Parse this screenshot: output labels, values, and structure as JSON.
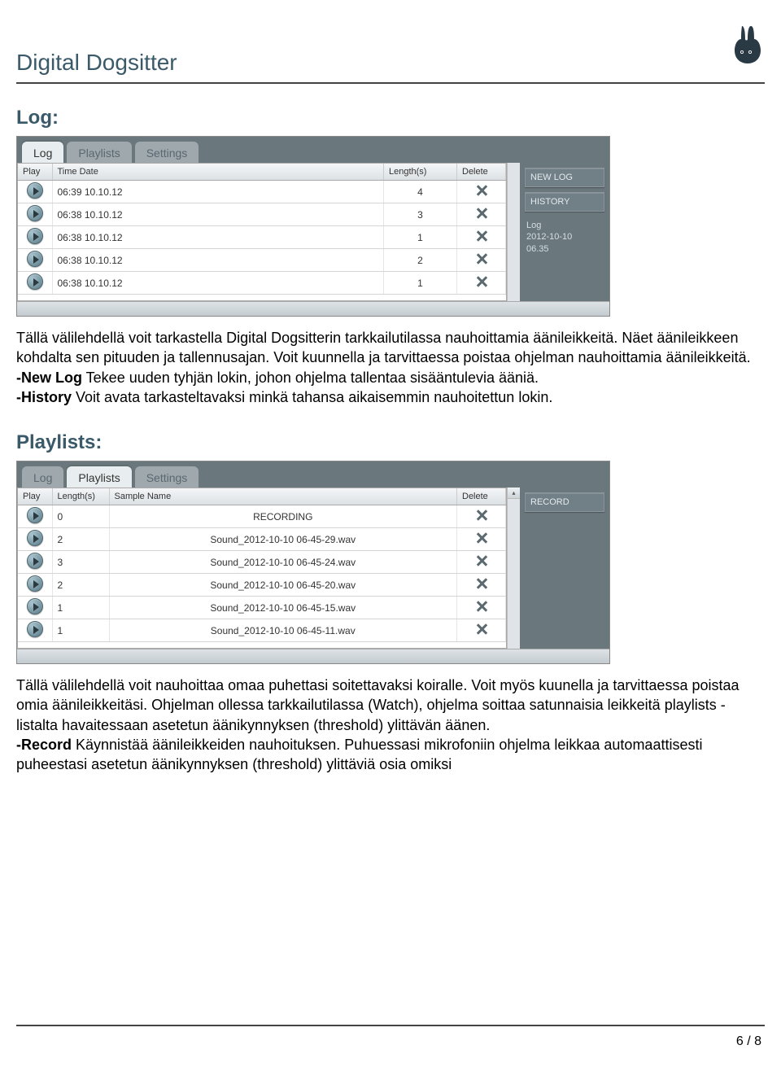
{
  "doc": {
    "title": "Digital Dogsitter",
    "page_num": "6 / 8"
  },
  "log_section": {
    "heading": "Log:",
    "tabs": [
      "Log",
      "Playlists",
      "Settings"
    ],
    "active_tab": 0,
    "columns": [
      "Play",
      "Time Date",
      "Length(s)",
      "Delete"
    ],
    "rows": [
      {
        "time": "06:39 10.10.12",
        "length": "4"
      },
      {
        "time": "06:38 10.10.12",
        "length": "3"
      },
      {
        "time": "06:38 10.10.12",
        "length": "1"
      },
      {
        "time": "06:38 10.10.12",
        "length": "2"
      },
      {
        "time": "06:38 10.10.12",
        "length": "1"
      }
    ],
    "side_buttons": [
      "NEW LOG",
      "HISTORY"
    ],
    "side_info_lines": [
      "Log",
      "2012-10-10",
      "06.35"
    ],
    "description": "Tällä välilehdellä voit tarkastella Digital Dogsitterin tarkkailutilassa nauhoittamia äänileikkeitä. Näet äänileikkeen kohdalta sen pituuden ja tallennusajan. Voit kuunnella ja tarvittaessa poistaa ohjelman nauhoittamia äänileikkeitä.",
    "bullets": [
      {
        "label": "-New Log",
        "text": " Tekee uuden tyhjän lokin, johon ohjelma tallentaa sisääntulevia ääniä."
      },
      {
        "label": "-History",
        "text": " Voit avata tarkasteltavaksi minkä tahansa aikaisemmin nauhoitettun lokin."
      }
    ]
  },
  "play_section": {
    "heading": "Playlists:",
    "tabs": [
      "Log",
      "Playlists",
      "Settings"
    ],
    "active_tab": 1,
    "columns": [
      "Play",
      "Length(s)",
      "Sample Name",
      "Delete"
    ],
    "rows": [
      {
        "length": "0",
        "name": "RECORDING"
      },
      {
        "length": "2",
        "name": "Sound_2012-10-10 06-45-29.wav"
      },
      {
        "length": "3",
        "name": "Sound_2012-10-10 06-45-24.wav"
      },
      {
        "length": "2",
        "name": "Sound_2012-10-10 06-45-20.wav"
      },
      {
        "length": "1",
        "name": "Sound_2012-10-10 06-45-15.wav"
      },
      {
        "length": "1",
        "name": "Sound_2012-10-10 06-45-11.wav"
      }
    ],
    "side_buttons": [
      "RECORD"
    ],
    "description": "Tällä välilehdellä voit nauhoittaa omaa puhettasi soitettavaksi koiralle. Voit myös kuunella ja tarvittaessa poistaa omia äänileikkeitäsi. Ohjelman ollessa tarkkailutilassa (Watch), ohjelma soittaa satunnaisia leikkeitä playlists -listalta havaitessaan asetetun äänikynnyksen (threshold) ylittävän äänen.",
    "bullets": [
      {
        "label": "-Record",
        "text": " Käynnistää äänileikkeiden nauhoituksen. Puhuessasi mikrofoniin ohjelma leikkaa automaattisesti puheestasi asetetun äänikynnyksen (threshold) ylittäviä osia omiksi"
      }
    ]
  }
}
